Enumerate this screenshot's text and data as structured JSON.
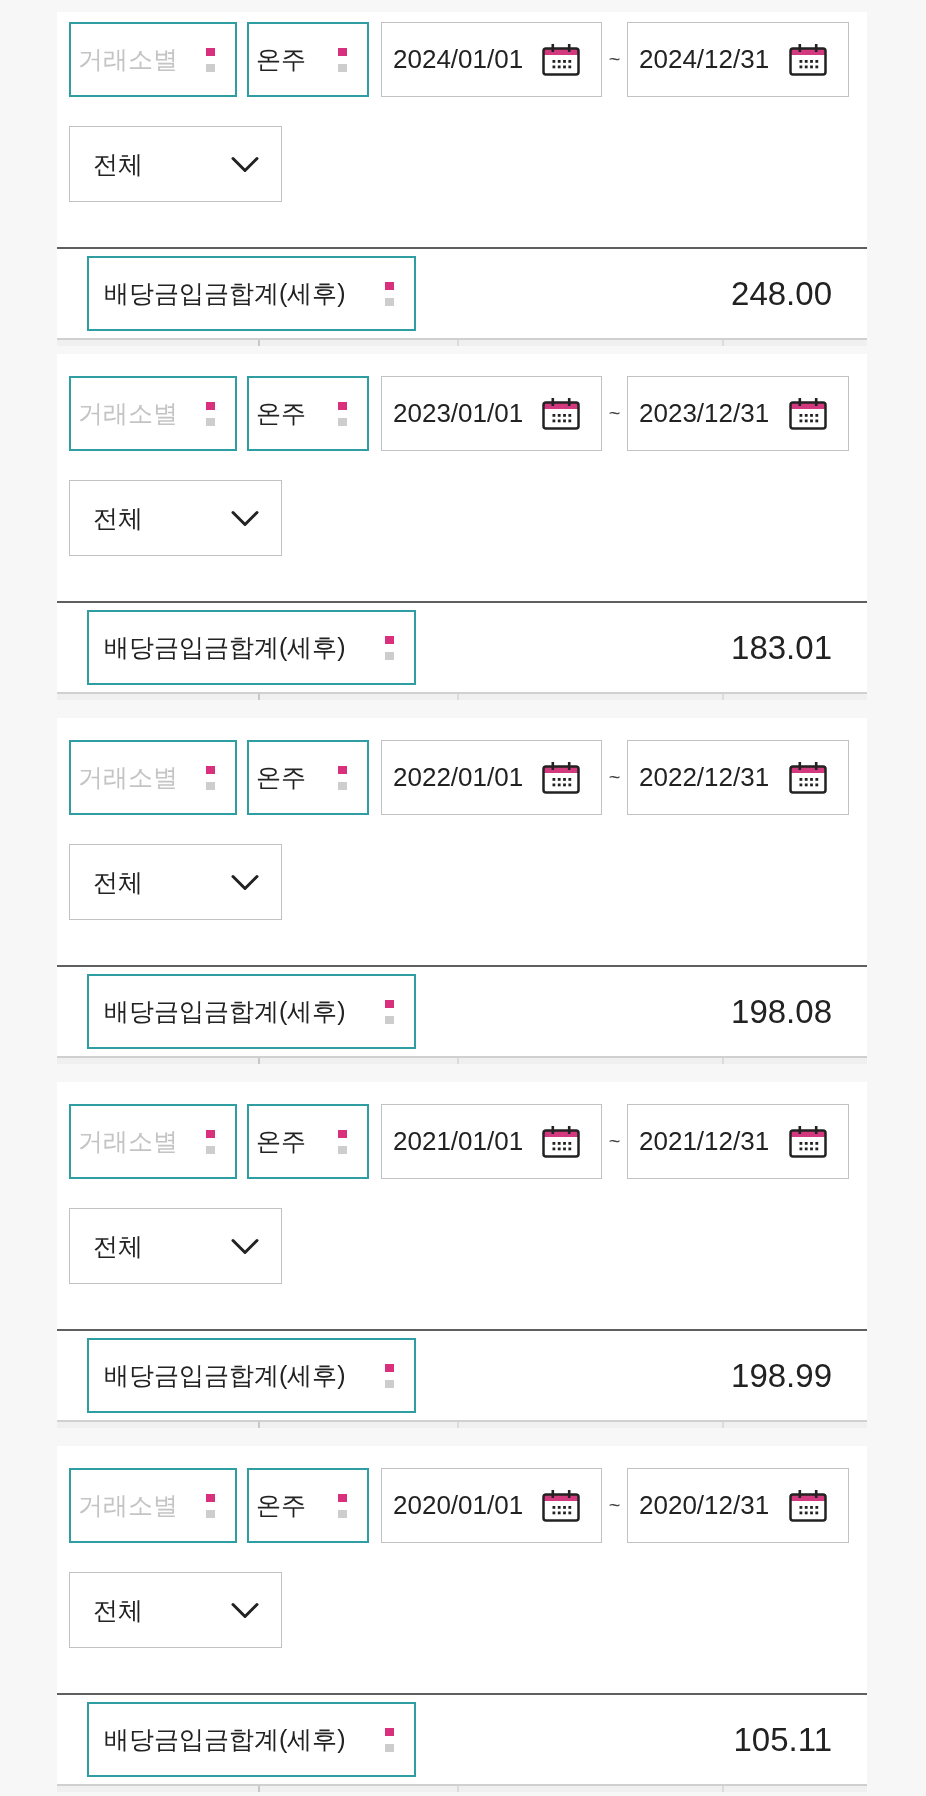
{
  "query_panels": [
    {
      "exchange_select": {
        "placeholder": "거래소별"
      },
      "share_type_select": {
        "value": "온주"
      },
      "date_range": {
        "start": "2024/01/01",
        "separator": "~",
        "end": "2024/12/31"
      },
      "category_dropdown": {
        "value": "전체"
      },
      "summary": {
        "label": "배당금입금합계(세후)",
        "amount": "248.00"
      }
    },
    {
      "exchange_select": {
        "placeholder": "거래소별"
      },
      "share_type_select": {
        "value": "온주"
      },
      "date_range": {
        "start": "2023/01/01",
        "separator": "~",
        "end": "2023/12/31"
      },
      "category_dropdown": {
        "value": "전체"
      },
      "summary": {
        "label": "배당금입금합계(세후)",
        "amount": "183.01"
      }
    },
    {
      "exchange_select": {
        "placeholder": "거래소별"
      },
      "share_type_select": {
        "value": "온주"
      },
      "date_range": {
        "start": "2022/01/01",
        "separator": "~",
        "end": "2022/12/31"
      },
      "category_dropdown": {
        "value": "전체"
      },
      "summary": {
        "label": "배당금입금합계(세후)",
        "amount": "198.08"
      }
    },
    {
      "exchange_select": {
        "placeholder": "거래소별"
      },
      "share_type_select": {
        "value": "온주"
      },
      "date_range": {
        "start": "2021/01/01",
        "separator": "~",
        "end": "2021/12/31"
      },
      "category_dropdown": {
        "value": "전체"
      },
      "summary": {
        "label": "배당금입금합계(세후)",
        "amount": "198.99"
      }
    },
    {
      "exchange_select": {
        "placeholder": "거래소별"
      },
      "share_type_select": {
        "value": "온주"
      },
      "date_range": {
        "start": "2020/01/01",
        "separator": "~",
        "end": "2020/12/31"
      },
      "category_dropdown": {
        "value": "전체"
      },
      "summary": {
        "label": "배당금입금합계(세후)",
        "amount": "105.11"
      }
    }
  ]
}
